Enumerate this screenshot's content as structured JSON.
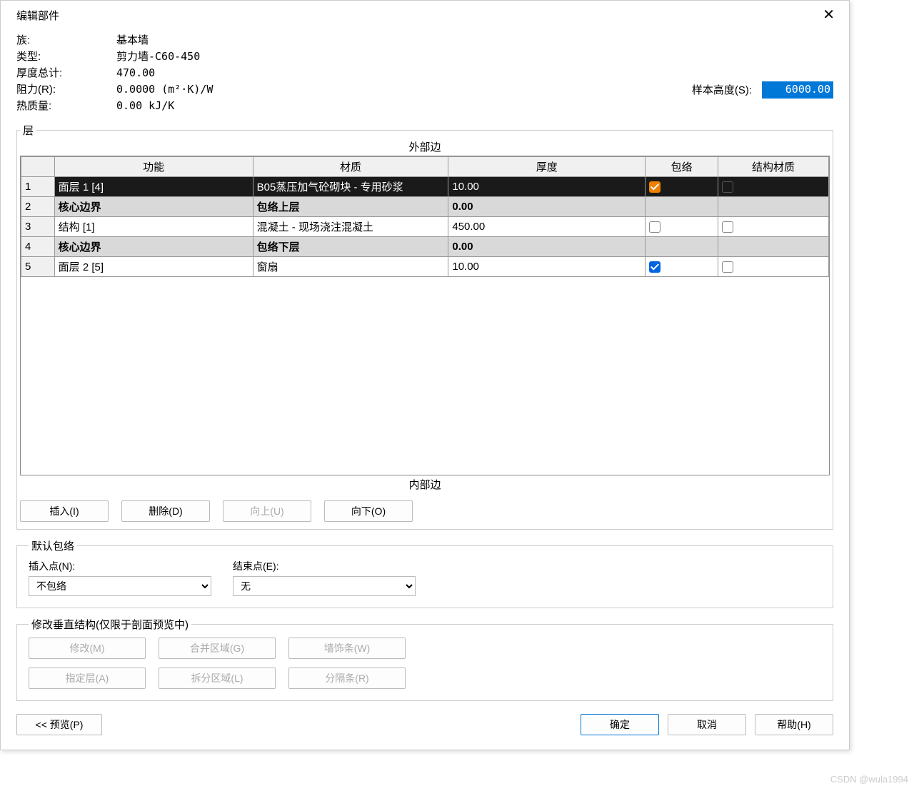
{
  "title": "编辑部件",
  "props": {
    "family_label": "族:",
    "family_value": "基本墙",
    "type_label": "类型:",
    "type_value": "剪力墙-C60-450",
    "thickness_label": "厚度总计:",
    "thickness_value": "470.00",
    "resistance_label": "阻力(R):",
    "resistance_value": "0.0000 (m²·K)/W",
    "thermal_label": "热质量:",
    "thermal_value": "0.00 kJ/K"
  },
  "sample_height": {
    "label": "样本高度(S):",
    "value": "6000.00"
  },
  "layers_group": {
    "legend": "层",
    "outer_label": "外部边",
    "inner_label": "内部边",
    "headers": {
      "func": "功能",
      "material": "材质",
      "thickness": "厚度",
      "wrap": "包络",
      "structural": "结构材质"
    },
    "rows": [
      {
        "idx": "1",
        "func": "面层 1 [4]",
        "material": "B05蒸压加气砼砌块 - 专用砂浆",
        "thickness": "10.00",
        "wrap": "checked-orange",
        "struct": "dark",
        "selected": true
      },
      {
        "idx": "2",
        "func": "核心边界",
        "material": "包络上层",
        "thickness": "0.00",
        "wrap": "",
        "struct": "",
        "core": true
      },
      {
        "idx": "3",
        "func": "结构 [1]",
        "material": "混凝土 - 现场浇注混凝土",
        "thickness": "450.00",
        "wrap": "unchecked",
        "struct": "unchecked"
      },
      {
        "idx": "4",
        "func": "核心边界",
        "material": "包络下层",
        "thickness": "0.00",
        "wrap": "",
        "struct": "",
        "core": true
      },
      {
        "idx": "5",
        "func": "面层 2 [5]",
        "material": "窗扇",
        "thickness": "10.00",
        "wrap": "checked",
        "struct": "unchecked"
      }
    ],
    "buttons": {
      "insert": "插入(I)",
      "delete": "删除(D)",
      "up": "向上(U)",
      "down": "向下(O)"
    }
  },
  "wrap_group": {
    "legend": "默认包络",
    "insert_label": "插入点(N):",
    "insert_value": "不包络",
    "end_label": "结束点(E):",
    "end_value": "无"
  },
  "vstruct_group": {
    "legend": "修改垂直结构(仅限于剖面预览中)",
    "modify": "修改(M)",
    "merge": "合并区域(G)",
    "sweeps": "墙饰条(W)",
    "assign": "指定层(A)",
    "split": "拆分区域(L)",
    "reveals": "分隔条(R)"
  },
  "footer": {
    "preview": "<< 预览(P)",
    "ok": "确定",
    "cancel": "取消",
    "help": "帮助(H)"
  },
  "watermark": "CSDN @wula1994"
}
